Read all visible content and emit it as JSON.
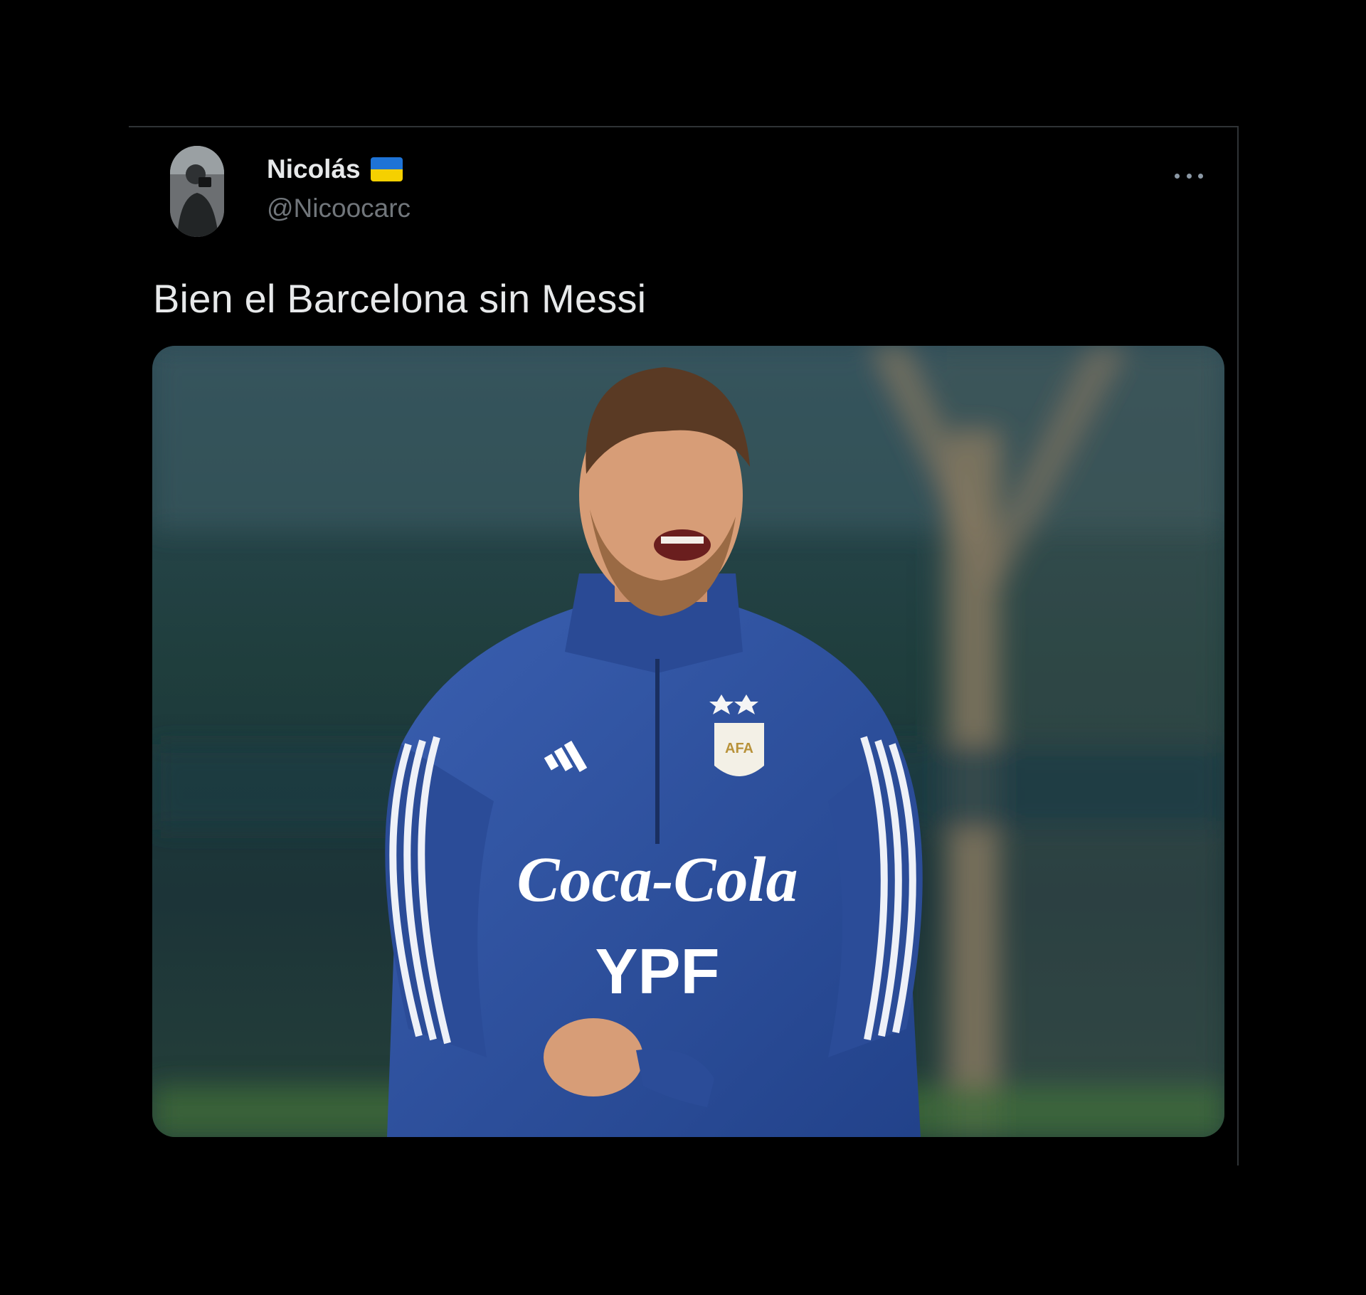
{
  "tweet": {
    "author": {
      "display_name": "Nicolás",
      "handle": "@Nicoocarc",
      "flag": "ukraine-flag-icon"
    },
    "text": "Bien el Barcelona sin Messi",
    "more_icon": "more-options-icon",
    "media": {
      "description": "photo of smiling football player in blue training jacket",
      "jacket_texts": [
        "Coca-Cola",
        "YPF",
        "AFA"
      ]
    }
  },
  "colors": {
    "background": "#000000",
    "primary_text": "#e7e9ea",
    "secondary_text": "#71767b",
    "jacket_blue": "#2c4f9e",
    "flag_blue": "#1e73d6",
    "flag_yellow": "#f5d000"
  }
}
